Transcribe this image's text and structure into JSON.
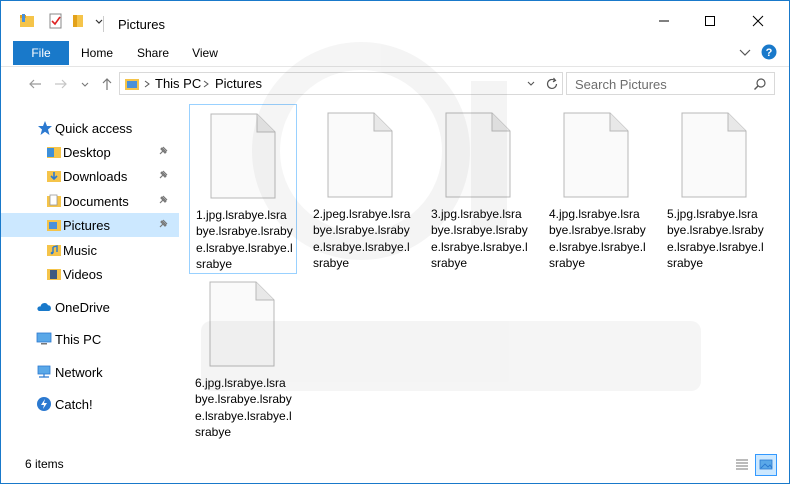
{
  "window": {
    "title": "Pictures"
  },
  "ribbon": {
    "tabs": [
      "File",
      "Home",
      "Share",
      "View"
    ]
  },
  "address": {
    "crumbs": [
      "This PC",
      "Pictures"
    ],
    "search_placeholder": "Search Pictures"
  },
  "sidebar": {
    "items": [
      {
        "label": "Quick access",
        "icon": "star-icon"
      },
      {
        "label": "Desktop",
        "icon": "folder-icon",
        "pinned": true
      },
      {
        "label": "Downloads",
        "icon": "downloads-icon",
        "pinned": true
      },
      {
        "label": "Documents",
        "icon": "documents-icon",
        "pinned": true
      },
      {
        "label": "Pictures",
        "icon": "pictures-icon",
        "pinned": true,
        "selected": true
      },
      {
        "label": "Music",
        "icon": "music-icon"
      },
      {
        "label": "Videos",
        "icon": "videos-icon"
      },
      {
        "label": "OneDrive",
        "icon": "cloud-icon"
      },
      {
        "label": "This PC",
        "icon": "computer-icon"
      },
      {
        "label": "Network",
        "icon": "network-icon"
      },
      {
        "label": "Catch!",
        "icon": "catch-icon"
      }
    ]
  },
  "files": [
    {
      "name": "1.jpg.lsrabye.lsrabye.lsrabye.lsrabye.lsrabye.lsrabye",
      "lines": [
        "1.jpg.lsrabye.lsra",
        "bye.lsrabye.lsraby",
        "e.lsrabye.lsrabye.l",
        "srabye"
      ]
    },
    {
      "name": "2.jpeg.lsrabye.lsrabye.lsrabye.lsrabye.lsrabye.lsrabye",
      "lines": [
        "2.jpeg.lsrabye.lsra",
        "bye.lsrabye.lsraby",
        "e.lsrabye.lsrabye.l",
        "srabye"
      ]
    },
    {
      "name": "3.jpg.lsrabye.lsrabye.lsrabye.lsrabye.lsrabye.lsrabye",
      "lines": [
        "3.jpg.lsrabye.lsra",
        "bye.lsrabye.lsraby",
        "e.lsrabye.lsrabye.l",
        "srabye"
      ]
    },
    {
      "name": "4.jpg.lsrabye.lsrabye.lsrabye.lsrabye.lsrabye.lsrabye",
      "lines": [
        "4.jpg.lsrabye.lsra",
        "bye.lsrabye.lsraby",
        "e.lsrabye.lsrabye.l",
        "srabye"
      ]
    },
    {
      "name": "5.jpg.lsrabye.lsrabye.lsrabye.lsrabye.lsrabye.lsrabye",
      "lines": [
        "5.jpg.lsrabye.lsra",
        "bye.lsrabye.lsraby",
        "e.lsrabye.lsrabye.l",
        "srabye"
      ]
    },
    {
      "name": "6.jpg.lsrabye.lsrabye.lsrabye.lsrabye.lsrabye.lsrabye",
      "lines": [
        "6.jpg.lsrabye.lsra",
        "bye.lsrabye.lsraby",
        "e.lsrabye.lsrabye.l",
        "srabye"
      ]
    }
  ],
  "status": {
    "item_count": "6 items"
  },
  "colors": {
    "accent": "#1979ca",
    "selection": "#cce8ff",
    "folder": "#f5c44a"
  }
}
